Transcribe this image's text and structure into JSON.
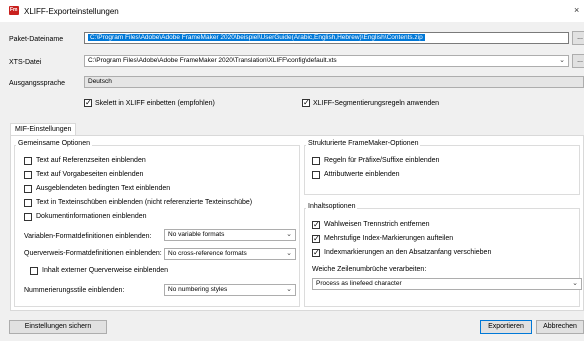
{
  "window": {
    "title": "XLIFF-Exporteinstellungen",
    "app_icon_text": "Fm",
    "close_glyph": "×"
  },
  "form": {
    "package_file_label": "Paket-Dateiname",
    "package_file_value": "C:\\Program Files\\Adobe\\Adobe FrameMaker 2020\\beispiel\\UserGuide(Arabic,English,Hebrew)\\English\\Contents.zip",
    "package_browse_label": "...",
    "xts_file_label": "XTS-Datei",
    "xts_file_value": "C:\\Program Files\\Adobe\\Adobe FrameMaker 2020\\Translation\\XLIFF\\config\\default.xts",
    "xts_browse_label": "...",
    "source_language_label": "Ausgangssprache",
    "source_language_value": "Deutsch",
    "embed_skeleton_label": "Skelett in XLIFF einbetten (empfohlen)",
    "embed_skeleton_checked": true,
    "apply_segmentation_label": "XLIFF-Segmentierungsregeln anwenden",
    "apply_segmentation_checked": true
  },
  "tabs": [
    {
      "label": "MIF-Einstellungen",
      "active": true
    }
  ],
  "common_options": {
    "title": "Gemeinsame Optionen",
    "checkboxes": [
      {
        "label": "Text auf Referenzseiten einblenden",
        "checked": false
      },
      {
        "label": "Text auf Vorgabeseiten einblenden",
        "checked": false
      },
      {
        "label": "Ausgeblendeten bedingten Text einblenden",
        "checked": false
      },
      {
        "label": "Text in Texteinschüben einblenden (nicht referenzierte Texteinschübe)",
        "checked": false
      },
      {
        "label": "Dokumentinformationen einblenden",
        "checked": false
      }
    ],
    "variable_defs_label": "Variablen-Formatdefinitionen einblenden:",
    "variable_defs_value": "No variable formats",
    "xref_defs_label": "Querverweis-Formatdefinitionen einblenden:",
    "xref_defs_value": "No cross-reference formats",
    "external_xref_label": "Inhalt externer Querverweise einblenden",
    "external_xref_checked": false,
    "numbering_label": "Nummerierungsstile einblenden:",
    "numbering_value": "No numbering styles"
  },
  "structured_options": {
    "title": "Strukturierte FrameMaker-Optionen",
    "checkboxes": [
      {
        "label": "Regeln für Präfixe/Suffixe einblenden",
        "checked": false
      },
      {
        "label": "Attributwerte einblenden",
        "checked": false
      }
    ]
  },
  "content_options": {
    "title": "Inhaltsoptionen",
    "checkboxes": [
      {
        "label": "Wahlweisen Trennstrich entfernen",
        "checked": true
      },
      {
        "label": "Mehrstufige Index-Markierungen aufteilen",
        "checked": true
      },
      {
        "label": "Indexmarkierungen an den Absatzanfang verschieben",
        "checked": true
      }
    ],
    "soft_breaks_label": "Weiche Zeilenumbrüche verarbeiten:",
    "soft_breaks_value": "Process as linefeed character"
  },
  "footer": {
    "save_settings_label": "Einstellungen sichern",
    "export_label": "Exportieren",
    "cancel_label": "Abbrechen"
  },
  "icons": {
    "dropdown_arrow": "⌄",
    "dropdown_icon_name": "chevron-down-icon",
    "checkmark_icon_name": "checkmark-icon"
  },
  "colors": {
    "selection_blue": "#0078d7",
    "app_icon_red": "#c9211e"
  }
}
